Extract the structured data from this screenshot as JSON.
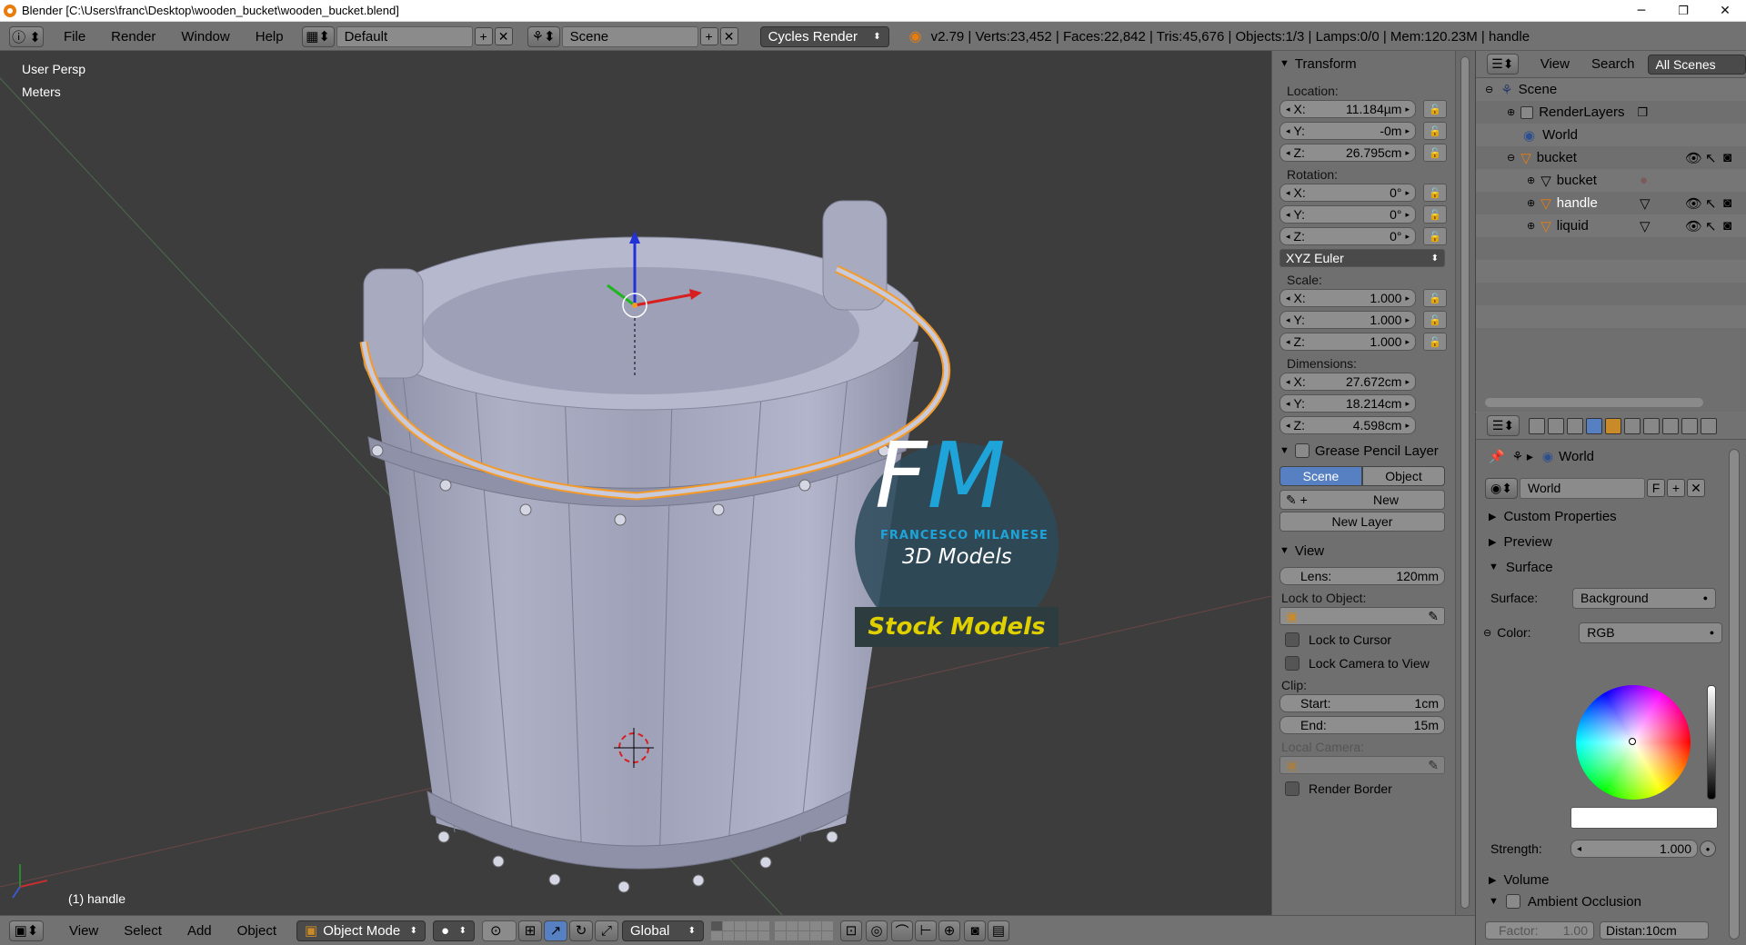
{
  "window": {
    "title": "Blender [C:\\Users\\franc\\Desktop\\wooden_bucket\\wooden_bucket.blend]",
    "minimize": "─",
    "maximize": "❐",
    "close": "✕"
  },
  "infobar": {
    "menus": [
      "File",
      "Render",
      "Window",
      "Help"
    ],
    "screen_layout": "Default",
    "scene": "Scene",
    "engine": "Cycles Render",
    "stats": "v2.79 | Verts:23,452 | Faces:22,842 | Tris:45,676 | Objects:1/3 | Lamps:0/0 | Mem:120.23M | handle"
  },
  "viewport": {
    "view_label": "User Persp",
    "units_label": "Meters",
    "active_object": "(1) handle",
    "watermark": {
      "initials_f": "F",
      "initials_m": "M",
      "author": "FRANCESCO MILANESE",
      "tagline": "3D Models",
      "banner": "Stock Models"
    }
  },
  "npanel": {
    "transform_title": "Transform",
    "location_label": "Location:",
    "location": [
      {
        "axis": "X:",
        "value": "11.184µm"
      },
      {
        "axis": "Y:",
        "value": "-0m"
      },
      {
        "axis": "Z:",
        "value": "26.795cm"
      }
    ],
    "rotation_label": "Rotation:",
    "rotation": [
      {
        "axis": "X:",
        "value": "0°"
      },
      {
        "axis": "Y:",
        "value": "0°"
      },
      {
        "axis": "Z:",
        "value": "0°"
      }
    ],
    "rotation_mode": "XYZ Euler",
    "scale_label": "Scale:",
    "scale": [
      {
        "axis": "X:",
        "value": "1.000"
      },
      {
        "axis": "Y:",
        "value": "1.000"
      },
      {
        "axis": "Z:",
        "value": "1.000"
      }
    ],
    "dimensions_label": "Dimensions:",
    "dimensions": [
      {
        "axis": "X:",
        "value": "27.672cm"
      },
      {
        "axis": "Y:",
        "value": "18.214cm"
      },
      {
        "axis": "Z:",
        "value": "4.598cm"
      }
    ],
    "grease_title": "Grease Pencil Layer",
    "grease_tab_scene": "Scene",
    "grease_tab_object": "Object",
    "grease_new": "New",
    "grease_new_layer": "New Layer",
    "view_title": "View",
    "lens_label": "Lens:",
    "lens_value": "120mm",
    "lock_object_label": "Lock to Object:",
    "lock_cursor": "Lock to Cursor",
    "lock_camera": "Lock Camera to View",
    "clip_label": "Clip:",
    "clip_start_label": "Start:",
    "clip_start": "1cm",
    "clip_end_label": "End:",
    "clip_end": "15m",
    "local_camera_label": "Local Camera:",
    "render_border": "Render Border"
  },
  "outliner": {
    "menu_view": "View",
    "menu_search": "Search",
    "filter": "All Scenes",
    "items": [
      {
        "label": "Scene"
      },
      {
        "label": "RenderLayers"
      },
      {
        "label": "World"
      },
      {
        "label": "bucket"
      },
      {
        "label": "bucket"
      },
      {
        "label": "handle"
      },
      {
        "label": "liquid"
      }
    ]
  },
  "properties": {
    "context_label": "World",
    "world_name": "World",
    "fake_user": "F",
    "sections": {
      "custom_props": "Custom Properties",
      "preview": "Preview",
      "surface": "Surface",
      "volume": "Volume",
      "ambient_occlusion": "Ambient Occlusion"
    },
    "surface_label": "Surface:",
    "surface_value": "Background",
    "color_label": "Color:",
    "color_mode": "RGB",
    "strength_label": "Strength:",
    "strength_value": "1.000",
    "factor_label": "Factor:",
    "factor_value": "1.00",
    "distance_label": "Distan:",
    "distance_value": "10cm"
  },
  "bottombar": {
    "menus": [
      "View",
      "Select",
      "Add",
      "Object"
    ],
    "mode": "Object Mode",
    "orientation": "Global"
  },
  "colors": {
    "accent_blue": "#5680c2",
    "fm_blue": "#1fa4d9",
    "banner_yellow": "#e0d000",
    "selection_orange": "#f39a2a"
  }
}
